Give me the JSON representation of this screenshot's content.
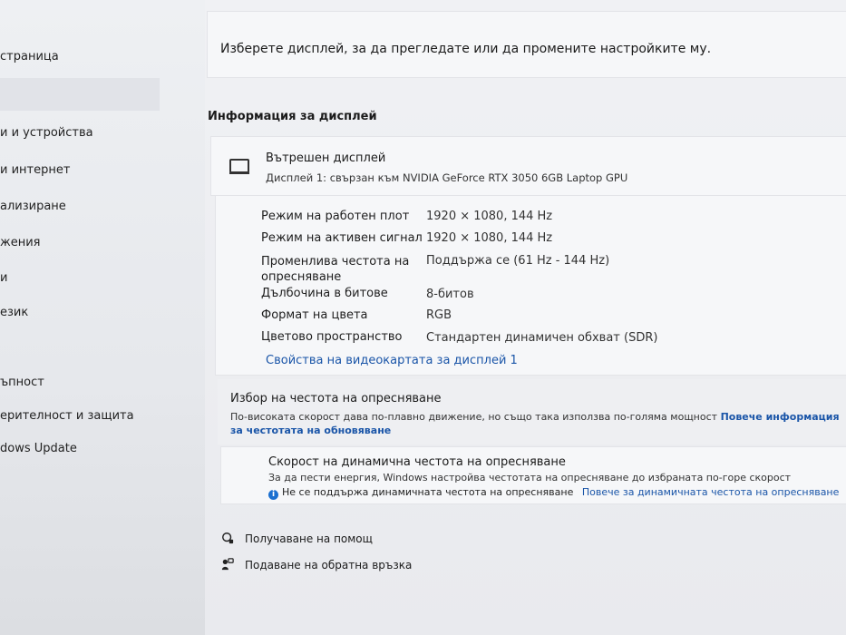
{
  "sidebar": {
    "items": [
      {
        "label": "страница"
      },
      {
        "label": "и и устройства"
      },
      {
        "label": "и интернет"
      },
      {
        "label": "ализиране"
      },
      {
        "label": "жения"
      },
      {
        "label": "и"
      },
      {
        "label": "език"
      },
      {
        "label": "ъпност"
      },
      {
        "label": "ерителност и защита"
      },
      {
        "label": "dows Update"
      }
    ]
  },
  "top_card": {
    "message": "Изберете дисплей, за да прегледате или да промените настройките му."
  },
  "display_info": {
    "section_title": "Информация за дисплей",
    "display_name": "Вътрешен дисплей",
    "display_subtitle": "Дисплей 1: свързан към NVIDIA GeForce RTX 3050 6GB Laptop GPU",
    "rows": [
      {
        "label": "Режим на работен плот",
        "value": "1920 × 1080, 144 Hz"
      },
      {
        "label": "Режим на активен сигнал",
        "value": "1920 × 1080, 144 Hz"
      },
      {
        "label": "Променлива честота на опресняване",
        "value": "Поддържа се (61 Hz - 144 Hz)"
      },
      {
        "label": "Дълбочина в битове",
        "value": "8-битов"
      },
      {
        "label": "Формат на цвета",
        "value": "RGB"
      },
      {
        "label": "Цветово пространство",
        "value": "Стандартен динамичен обхват (SDR)"
      }
    ],
    "gpu_link": "Свойства на видеокартата за дисплей 1"
  },
  "refresh_rate": {
    "title": "Избор на честота на опресняване",
    "description": "По-високата скорост дава по-плавно движение, но също така използва по-голяма мощност",
    "more_link": "Повече информация за честотата на обновяване"
  },
  "dynamic_rate": {
    "title": "Скорост на динамична честота на опресняване",
    "description": "За да пести енергия, Windows настройва честотата на опресняване до избраната по-горе скорост",
    "note": "Не се поддържа динамичната честота на опресняване",
    "note_link": "Повече за динамичната честота на опресняване"
  },
  "help": {
    "get_help": "Получаване на помощ",
    "feedback": "Подаване на обратна връзка"
  },
  "colors": {
    "accent": "#1a55a8",
    "info_badge": "#1a6fd0"
  }
}
